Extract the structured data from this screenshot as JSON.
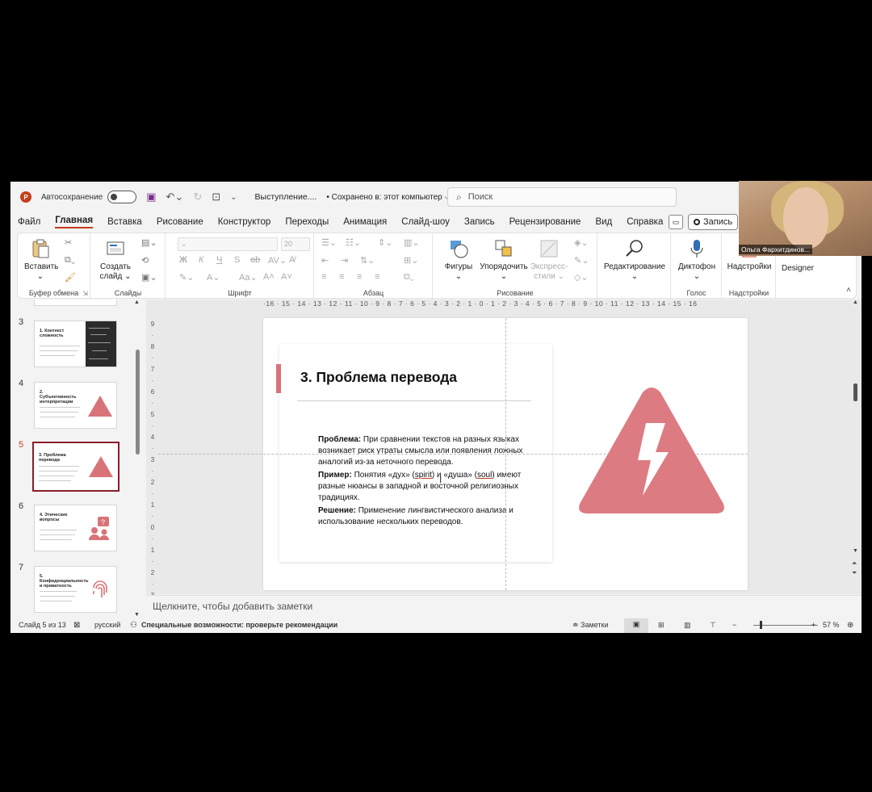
{
  "titlebar": {
    "autosave_label": "Автосохранение",
    "doc_title": "Выступление....",
    "saved_status": "• Сохранено в: этот компьютер ⌵",
    "search_placeholder": "Поиск"
  },
  "webcam": {
    "participant_name": "Ольга Фархитдинов..."
  },
  "menu": {
    "tabs": [
      "Файл",
      "Главная",
      "Вставка",
      "Рисование",
      "Конструктор",
      "Переходы",
      "Анимация",
      "Слайд-шоу",
      "Запись",
      "Рецензирование",
      "Вид",
      "Справка"
    ],
    "active_tab": "Главная",
    "record_label": "Запись"
  },
  "ribbon": {
    "paste": "Вставить",
    "clipboard_group": "Буфер обмена",
    "new_slide": "Создать слайд",
    "slides_group": "Слайды",
    "font_size": "20",
    "font_group": "Шрифт",
    "paragraph_group": "Абзац",
    "shapes": "Фигуры",
    "arrange": "Упорядочить",
    "quick_styles": "Экспресс-стили",
    "drawing_group": "Рисование",
    "editing": "Редактирование",
    "dictate": "Диктофон",
    "voice_group": "Голос",
    "addins": "Надстройки",
    "addins_group": "Надстройки",
    "designer": "Designer"
  },
  "slides_panel": {
    "thumbnails": [
      {
        "num": "3",
        "title": "1. Контекст сложность"
      },
      {
        "num": "4",
        "title": "2. Субъективность интерпретации"
      },
      {
        "num": "5",
        "title": "3. Проблема перевода"
      },
      {
        "num": "6",
        "title": "4. Этические вопросы"
      },
      {
        "num": "7",
        "title": "5. Конфиденциальность и приватность"
      }
    ],
    "selected": "5"
  },
  "ruler": {
    "horizontal": "·16 · 15 · 14 · 13 · 12 · 11 · 10 · 9 · 8 · 7 · 6 · 5 · 4 · 3 · 2 · 1 · 0 · 1 · 2 · 3 · 4 · 5 · 6 · 7 · 8 · 9 · 10 · 11 · 12 · 13 · 14 · 15 · 16"
  },
  "slide": {
    "title": "3. Проблема перевода",
    "problem_label": "Проблема:",
    "problem_text": " При сравнении текстов на разных языках возникает риск утраты смысла или появления ложных аналогий из-за неточного перевода.",
    "example_label": "Пример:",
    "example_text_1": " Понятия «дух» (",
    "example_spirit": "spirit",
    "example_text_2": ") и «душа» (",
    "example_soul": "soul",
    "example_text_3": ") имеют разные нюансы в западной и восточной религиозных традициях.",
    "solution_label": "Решение:",
    "solution_text": " Применение лингвистического анализа и использование нескольких переводов.",
    "icon": "warning-lightning-icon",
    "accent_color": "#d9737a"
  },
  "notes": {
    "placeholder": "Щелкните, чтобы добавить заметки"
  },
  "status": {
    "slide_counter": "Слайд 5 из 13",
    "language": "русский",
    "accessibility": "Специальные возможности: проверьте рекомендации",
    "notes_btn": "Заметки",
    "zoom": "57 %"
  }
}
